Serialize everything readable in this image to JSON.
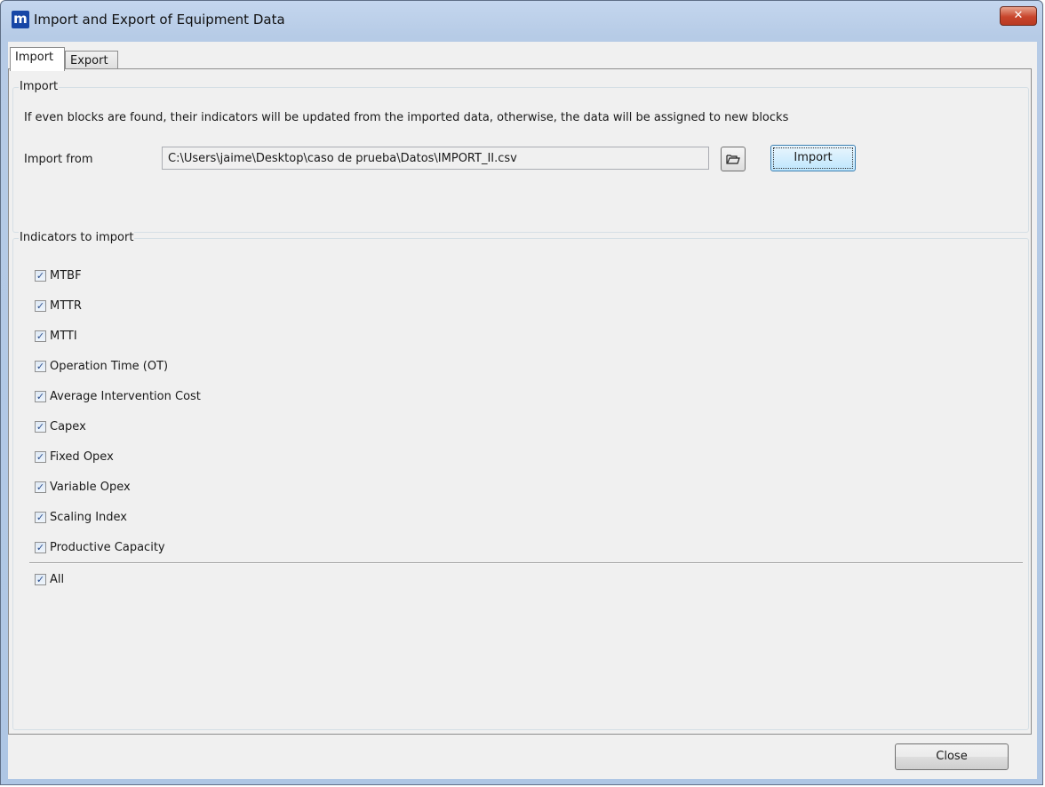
{
  "window": {
    "title": "Import and Export of Equipment Data",
    "close_glyph": "✕",
    "app_icon_letter": "m"
  },
  "tabs": [
    {
      "label": "Import",
      "active": true
    },
    {
      "label": "Export",
      "active": false
    }
  ],
  "import_group": {
    "title": "Import",
    "description": "If even blocks are found, their indicators will be updated from the imported data, otherwise, the data will be assigned to new blocks",
    "import_from_label": "Import from",
    "path_value": "C:\\Users\\jaime\\Desktop\\caso de prueba\\Datos\\IMPORT_II.csv",
    "browse_icon": "folder-open-icon",
    "import_button_label": "Import"
  },
  "indicators_group": {
    "title": "Indicators to import",
    "items": [
      {
        "label": "MTBF",
        "checked": true
      },
      {
        "label": "MTTR",
        "checked": true
      },
      {
        "label": "MTTI",
        "checked": true
      },
      {
        "label": "Operation Time (OT)",
        "checked": true
      },
      {
        "label": "Average Intervention Cost",
        "checked": true
      },
      {
        "label": "Capex",
        "checked": true
      },
      {
        "label": "Fixed Opex",
        "checked": true
      },
      {
        "label": "Variable Opex",
        "checked": true
      },
      {
        "label": "Scaling Index",
        "checked": true
      },
      {
        "label": "Productive Capacity",
        "checked": true
      }
    ],
    "all": {
      "label": "All",
      "checked": true
    }
  },
  "footer": {
    "close_button_label": "Close"
  },
  "colors": {
    "checkmark": "#2c4f8f",
    "app_icon_bg": "#1746a6",
    "close_button": "#c8452c"
  }
}
